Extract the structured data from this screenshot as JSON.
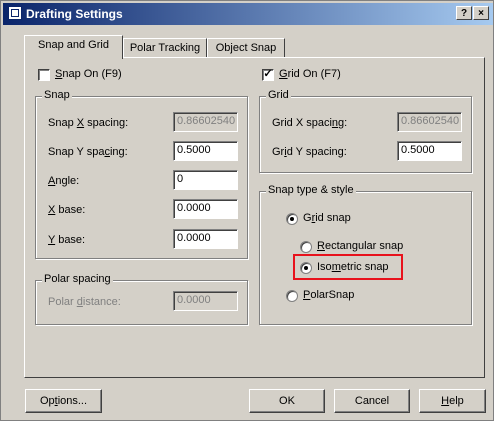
{
  "window": {
    "title": "Drafting Settings",
    "help_glyph": "?",
    "close_glyph": "×"
  },
  "tabs": [
    {
      "label": "Snap and Grid",
      "active": true
    },
    {
      "label": "Polar Tracking",
      "active": false
    },
    {
      "label": "Object Snap",
      "active": false
    }
  ],
  "snap_on": {
    "label_prefix": "",
    "label_mnemonic": "S",
    "label_rest": "nap On (F9)",
    "checked": false,
    "check_glyph": ""
  },
  "grid_on": {
    "label_mnemonic": "G",
    "label_rest": "rid On (F7)",
    "checked": true,
    "check_glyph": "✓"
  },
  "snap": {
    "title": "Snap",
    "x_spacing": {
      "label_a": "Snap ",
      "mnemonic": "X",
      "label_b": " spacing:",
      "value": "0.86602540",
      "disabled": true
    },
    "y_spacing": {
      "label_a": "Snap Y spa",
      "mnemonic": "c",
      "label_b": "ing:",
      "value": "0.5000"
    },
    "angle": {
      "label_a": "",
      "mnemonic": "A",
      "label_b": "ngle:",
      "value": "0"
    },
    "x_base": {
      "label_a": "",
      "mnemonic": "X",
      "label_b": " base:",
      "value": "0.0000"
    },
    "y_base": {
      "label_a": "",
      "mnemonic": "Y",
      "label_b": " base:",
      "value": "0.0000"
    }
  },
  "grid": {
    "title": "Grid",
    "x_spacing": {
      "label_a": "Grid X spaci",
      "mnemonic": "n",
      "label_b": "g:",
      "value": "0.86602540",
      "disabled": true
    },
    "y_spacing": {
      "label_a": "Gr",
      "mnemonic": "i",
      "label_b": "d Y spacing:",
      "value": "0.5000"
    }
  },
  "polar": {
    "title": "Polar spacing",
    "distance": {
      "label_a": "Polar ",
      "mnemonic": "d",
      "label_b": "istance:",
      "value": "0.0000",
      "disabled": true
    }
  },
  "snap_type": {
    "title": "Snap type & style",
    "grid_snap": {
      "label_a": "G",
      "mnemonic": "r",
      "label_b": "id snap",
      "selected": true
    },
    "rectangular": {
      "label_a": "",
      "mnemonic": "R",
      "label_b": "ectangular snap",
      "selected": false
    },
    "isometric": {
      "label_a": "Iso",
      "mnemonic": "m",
      "label_b": "etric snap",
      "selected": true
    },
    "polar_snap": {
      "label_a": "",
      "mnemonic": "P",
      "label_b": "olarSnap",
      "selected": false
    }
  },
  "buttons": {
    "options": {
      "label_a": "Op",
      "mnemonic": "t",
      "label_b": "ions..."
    },
    "ok": {
      "label": "OK"
    },
    "cancel": {
      "label": "Cancel"
    },
    "help": {
      "mnemonic": "H",
      "label_b": "elp"
    }
  },
  "colors": {
    "title_start": "#0a246a",
    "title_end": "#a6caf0",
    "face": "#d4d0c8",
    "highlight": "#e8121c"
  }
}
